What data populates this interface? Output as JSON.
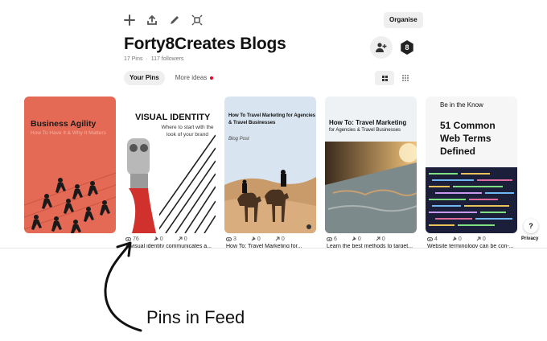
{
  "toolbar": {
    "icons": [
      "plus-icon",
      "share-icon",
      "edit-icon",
      "select-icon"
    ],
    "organise_label": "Organise"
  },
  "board": {
    "title": "Forty8Creates Blogs",
    "pins_count": "17 Pins",
    "separator": "·",
    "followers": "117 followers",
    "avatar_letter": "8"
  },
  "tabs": {
    "your_pins": "Your Pins",
    "more_ideas": "More ideas"
  },
  "pins": [
    {
      "image_title": "Business Agility",
      "image_subtitle": "How To Have It & Why It Matters",
      "saves": "",
      "repins": "",
      "clicks": "",
      "caption": ""
    },
    {
      "image_title": "VISUAL IDENTITY",
      "image_subtitle": "Where to start with the look of your brand",
      "saves": "76",
      "repins": "0",
      "clicks": "0",
      "caption": "A visual identity communicates a..."
    },
    {
      "image_title": "How To Travel Marketing for Agencies & Travel Businesses",
      "image_subtitle": "Blog Post",
      "saves": "3",
      "repins": "0",
      "clicks": "0",
      "caption": "How To: Travel Marketing for..."
    },
    {
      "image_title": "How To: Travel Marketing",
      "image_subtitle": "for Agencies & Travel Businesses",
      "saves": "6",
      "repins": "0",
      "clicks": "0",
      "caption": "Learn the best methods to target..."
    },
    {
      "image_eyebrow": "Be in the Know",
      "image_title": "51 Common Web Terms Defined",
      "saves": "4",
      "repins": "0",
      "clicks": "0",
      "caption": "Website terminology can be con-..."
    }
  ],
  "help": {
    "label": "?",
    "privacy": "Privacy"
  },
  "annotation": {
    "text": "Pins in Feed"
  },
  "colors": {
    "notification_dot": "#e60023",
    "business_agility_bg": "#e46a55",
    "tab_active_bg": "#efefef"
  }
}
